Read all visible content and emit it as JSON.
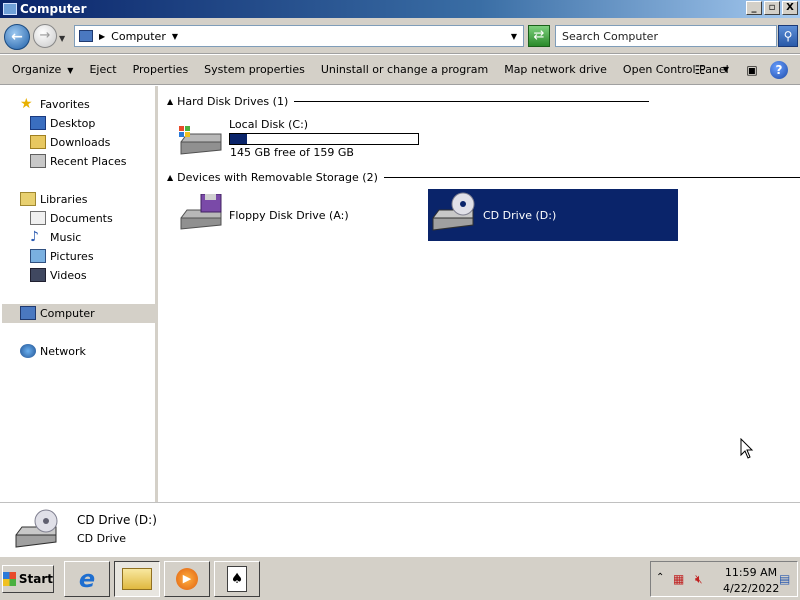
{
  "window": {
    "title": "Computer",
    "minimize": "_",
    "maximize": "▫",
    "close": "X"
  },
  "address": {
    "location": "Computer",
    "search_placeholder": "Search Computer"
  },
  "commands": {
    "organize": "Organize",
    "eject": "Eject",
    "properties": "Properties",
    "system_properties": "System properties",
    "uninstall": "Uninstall or change a program",
    "map_drive": "Map network drive",
    "control_panel": "Open Control Panel"
  },
  "nav": {
    "favorites": "Favorites",
    "desktop": "Desktop",
    "downloads": "Downloads",
    "recent": "Recent Places",
    "libraries": "Libraries",
    "documents": "Documents",
    "music": "Music",
    "pictures": "Pictures",
    "videos": "Videos",
    "computer": "Computer",
    "network": "Network"
  },
  "content": {
    "group_hdd": "Hard Disk Drives (1)",
    "group_removable": "Devices with Removable Storage (2)",
    "local_disk": {
      "name": "Local Disk (C:)",
      "free": "145 GB free of 159 GB",
      "used_fraction": 0.088
    },
    "floppy": {
      "name": "Floppy Disk Drive (A:)"
    },
    "cd": {
      "name": "CD Drive (D:)"
    }
  },
  "details": {
    "name": "CD Drive (D:)",
    "type": "CD Drive"
  },
  "taskbar": {
    "start": "Start",
    "time": "11:59 AM",
    "date": "4/22/2022"
  },
  "colors": {
    "selection": "#0a246a",
    "chrome": "#d4d0c8"
  }
}
